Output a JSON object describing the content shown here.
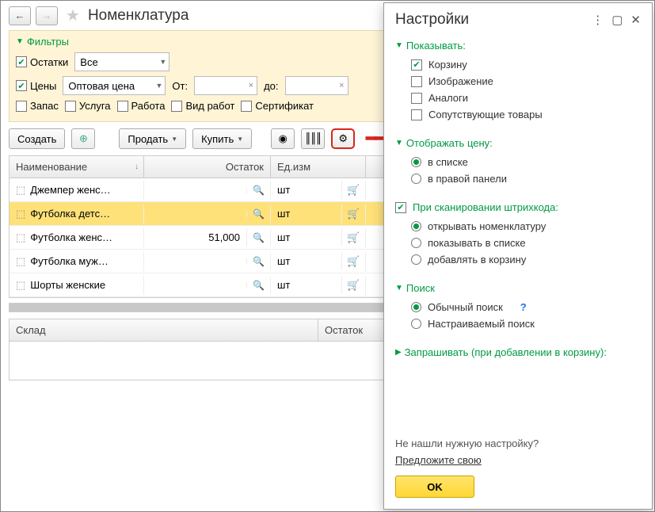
{
  "header": {
    "title": "Номенклатура"
  },
  "filters": {
    "label": "Фильтры",
    "ostatki_label": "Остатки",
    "ostatki_value": "Все",
    "ceny_label": "Цены",
    "ceny_value": "Оптовая цена",
    "ot_label": "От:",
    "do_label": "до:",
    "zapas": "Запас",
    "usluga": "Услуга",
    "rabota": "Работа",
    "vid_rabot": "Вид работ",
    "sertifikat": "Сертификат"
  },
  "actions": {
    "create": "Создать",
    "sell": "Продать",
    "buy": "Купить"
  },
  "grid": {
    "cols": {
      "name": "Наименование",
      "ostatok": "Остаток",
      "ed": "Ед.изм"
    },
    "rows": [
      {
        "name": "Джемпер женс…",
        "ostatok": "",
        "ed": "шт",
        "sel": false
      },
      {
        "name": "Футболка детс…",
        "ostatok": "",
        "ed": "шт",
        "sel": true
      },
      {
        "name": "Футболка женс…",
        "ostatok": "51,000",
        "ed": "шт",
        "sel": false
      },
      {
        "name": "Футболка муж…",
        "ostatok": "",
        "ed": "шт",
        "sel": false
      },
      {
        "name": "Шорты женские",
        "ostatok": "",
        "ed": "шт",
        "sel": false
      }
    ]
  },
  "bottom": {
    "sklad": "Склад",
    "ostatok": "Остаток"
  },
  "settings": {
    "title": "Настройки",
    "show": {
      "label": "Показывать:",
      "basket": "Корзину",
      "image": "Изображение",
      "analogs": "Аналоги",
      "related": "Сопутствующие товары"
    },
    "price": {
      "label": "Отображать цену:",
      "in_list": "в списке",
      "in_panel": "в правой панели"
    },
    "scan": {
      "label": "При сканировании штрихкода:",
      "open": "открывать номенклатуру",
      "show_list": "показывать в списке",
      "add_basket": "добавлять в корзину"
    },
    "search": {
      "label": "Поиск",
      "normal": "Обычный поиск",
      "custom": "Настраиваемый поиск"
    },
    "request": "Запрашивать (при добавлении в корзину):",
    "footer_q": "Не нашли нужную настройку?",
    "footer_link": "Предложите свою",
    "ok": "OK"
  }
}
